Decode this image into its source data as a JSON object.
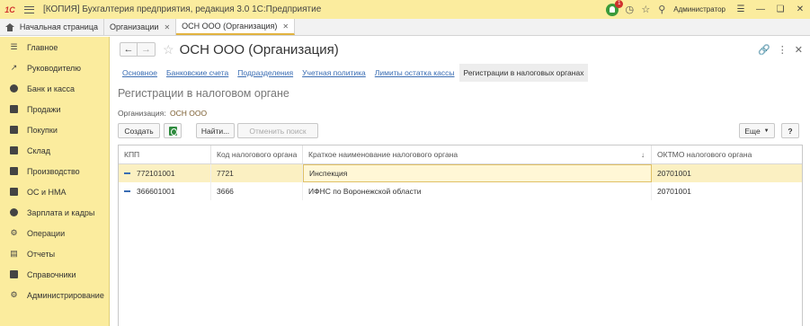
{
  "titlebar": {
    "logo": "1С",
    "title": "[КОПИЯ] Бухгалтерия предприятия, редакция 3.0 1С:Предприятие",
    "notifications_count": "1",
    "user": "Администратор"
  },
  "tabs": [
    {
      "label": "Начальная страница"
    },
    {
      "label": "Организации"
    },
    {
      "label": "ОСН ООО (Организация)"
    }
  ],
  "sidebar": {
    "items": [
      {
        "label": "Главное",
        "icon": "menu-icon"
      },
      {
        "label": "Руководителю",
        "icon": "chart-line-icon"
      },
      {
        "label": "Банк и касса",
        "icon": "bank-icon"
      },
      {
        "label": "Продажи",
        "icon": "cart-icon"
      },
      {
        "label": "Покупки",
        "icon": "basket-icon"
      },
      {
        "label": "Склад",
        "icon": "warehouse-icon"
      },
      {
        "label": "Производство",
        "icon": "factory-icon"
      },
      {
        "label": "ОС и НМА",
        "icon": "truck-icon"
      },
      {
        "label": "Зарплата и кадры",
        "icon": "person-icon"
      },
      {
        "label": "Операции",
        "icon": "operations-icon"
      },
      {
        "label": "Отчеты",
        "icon": "reports-icon"
      },
      {
        "label": "Справочники",
        "icon": "book-icon"
      },
      {
        "label": "Администрирование",
        "icon": "gear-icon"
      }
    ]
  },
  "form": {
    "title": "ОСН ООО (Организация)",
    "sections": [
      {
        "label": "Основное"
      },
      {
        "label": "Банковские счета"
      },
      {
        "label": "Подразделения"
      },
      {
        "label": "Учетная политика"
      },
      {
        "label": "Лимиты остатка кассы"
      },
      {
        "label": "Регистрации в налоговых органах"
      }
    ],
    "subtitle": "Регистрации в налоговом органе",
    "org_label": "Организация:",
    "org_value": "ОСН ООО",
    "buttons": {
      "create": "Создать",
      "find": "Найти...",
      "cancel_search": "Отменить поиск",
      "more": "Еще",
      "help": "?"
    },
    "table": {
      "columns": [
        "КПП",
        "Код налогового органа",
        "Краткое наименование налогового органа",
        "ОКТМО налогового органа"
      ],
      "rows": [
        [
          "772101001",
          "7721",
          "Инспекция",
          "20701001"
        ],
        [
          "366601001",
          "3666",
          "ИФНС по Воронежской области",
          "20701001"
        ]
      ]
    }
  }
}
